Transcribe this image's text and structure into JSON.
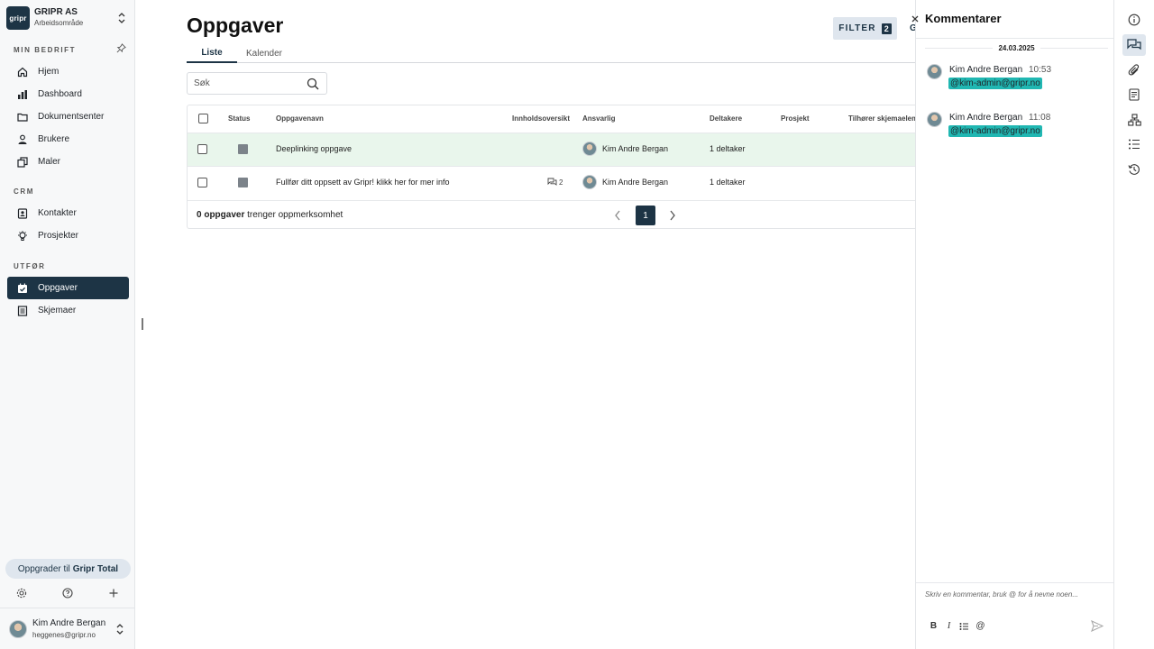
{
  "org": {
    "logo_text": "gripr",
    "name": "GRIPR AS",
    "subtitle": "Arbeidsområde"
  },
  "sidebar": {
    "sections": {
      "company": "MIN BEDRIFT",
      "crm": "CRM",
      "execute": "UTFØR"
    },
    "items": [
      {
        "label": "Hjem",
        "icon": "home-icon"
      },
      {
        "label": "Dashboard",
        "icon": "chart-icon"
      },
      {
        "label": "Dokumentsenter",
        "icon": "folder-icon"
      },
      {
        "label": "Brukere",
        "icon": "user-icon"
      },
      {
        "label": "Maler",
        "icon": "copy-icon"
      },
      {
        "label": "Kontakter",
        "icon": "contact-icon"
      },
      {
        "label": "Prosjekter",
        "icon": "bulb-icon"
      },
      {
        "label": "Oppgaver",
        "icon": "calendar-check-icon",
        "active": true
      },
      {
        "label": "Skjemaer",
        "icon": "form-icon"
      }
    ],
    "upgrade_prefix": "Oppgrader til",
    "upgrade_product": "Gripr Total",
    "user": {
      "name": "Kim Andre Bergan",
      "email": "heggenes@gripr.no"
    }
  },
  "main": {
    "title": "Oppgaver",
    "filter_label": "FILTER",
    "filter_count": "2",
    "cut_letter": "G",
    "tabs": [
      {
        "label": "Liste",
        "active": true
      },
      {
        "label": "Kalender"
      }
    ],
    "search_placeholder": "Søk",
    "table": {
      "headers": {
        "status": "Status",
        "name": "Oppgavenavn",
        "content": "Innholdsoversikt",
        "responsible": "Ansvarlig",
        "participants": "Deltakere",
        "project": "Prosjekt",
        "belongs": "Tilhører skjemaelemen"
      },
      "rows": [
        {
          "name": "Deeplinking oppgave",
          "comments": "",
          "responsible": "Kim Andre Bergan",
          "participants": "1 deltaker"
        },
        {
          "name": "Fullfør ditt oppsett av Gripr! klikk her for mer info",
          "comments": "2",
          "responsible": "Kim Andre Bergan",
          "participants": "1 deltaker"
        }
      ],
      "footer_count": "0 oppgaver",
      "footer_suffix": "trenger oppmerksomhet",
      "current_page": "1"
    }
  },
  "comments_panel": {
    "title": "Kommentarer",
    "date": "24.03.2025",
    "comments": [
      {
        "author": "Kim Andre Bergan",
        "time": "10:53",
        "mention": "@kim-admin@gripr.no"
      },
      {
        "author": "Kim Andre Bergan",
        "time": "11:08",
        "mention": "@kim-admin@gripr.no"
      }
    ],
    "composer_placeholder": "Skriv en kommentar, bruk @ for å nevne noen...",
    "mention_colour": "#20b7b2"
  },
  "right_rail": [
    {
      "icon": "info-icon"
    },
    {
      "icon": "comments-icon",
      "active": true
    },
    {
      "icon": "attachment-icon"
    },
    {
      "icon": "form-icon"
    },
    {
      "icon": "hierarchy-icon"
    },
    {
      "icon": "checklist-icon"
    },
    {
      "icon": "history-icon"
    }
  ],
  "colors": {
    "brand": "#1d3445",
    "row_highlight": "#e9f6ec",
    "filter_bg": "#dfe6ee"
  }
}
